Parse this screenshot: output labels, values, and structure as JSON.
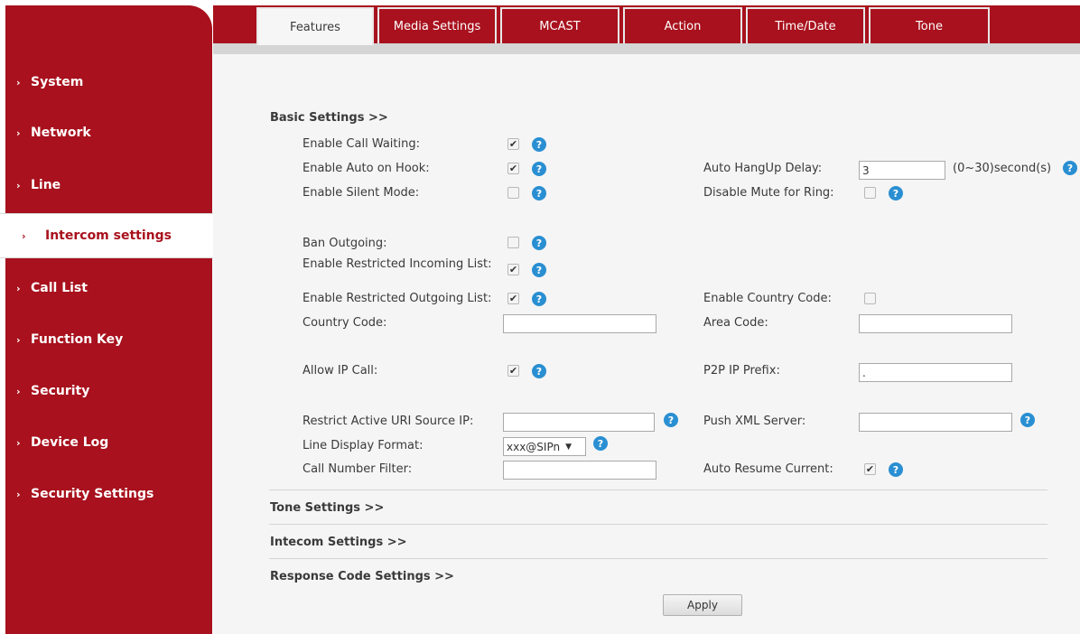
{
  "sidebar": {
    "items": [
      {
        "label": "System"
      },
      {
        "label": "Network"
      },
      {
        "label": "Line"
      },
      {
        "label": "Intercom settings"
      },
      {
        "label": "Call List"
      },
      {
        "label": "Function Key"
      },
      {
        "label": "Security"
      },
      {
        "label": "Device Log"
      },
      {
        "label": "Security Settings"
      }
    ],
    "active": "Intercom settings"
  },
  "tabs": [
    {
      "label": "Features"
    },
    {
      "label": "Media Settings"
    },
    {
      "label": "MCAST"
    },
    {
      "label": "Action"
    },
    {
      "label": "Time/Date"
    },
    {
      "label": "Tone"
    }
  ],
  "active_tab": "Features",
  "basic": {
    "title": "Basic Settings >>",
    "call_waiting": {
      "label": "Enable Call Waiting:",
      "checked": true
    },
    "auto_on_hook": {
      "label": "Enable Auto on Hook:",
      "checked": true
    },
    "silent_mode": {
      "label": "Enable Silent Mode:",
      "checked": false
    },
    "hangup_delay": {
      "label": "Auto HangUp Delay:",
      "value": "3",
      "unit": "(0~30)second(s)"
    },
    "disable_mute": {
      "label": "Disable Mute for Ring:",
      "checked": false
    },
    "ban_outgoing": {
      "label": "Ban Outgoing:",
      "checked": false
    },
    "restricted_incoming": {
      "label": "Enable Restricted Incoming List:",
      "checked": true
    },
    "restricted_outgoing": {
      "label": "Enable Restricted Outgoing List:",
      "checked": true
    },
    "country_code_enable": {
      "label": "Enable Country Code:",
      "checked": false
    },
    "country_code": {
      "label": "Country Code:",
      "value": ""
    },
    "area_code": {
      "label": "Area Code:",
      "value": ""
    },
    "allow_ip_call": {
      "label": "Allow IP Call:",
      "checked": true
    },
    "p2p_prefix": {
      "label": "P2P IP Prefix:",
      "value": "."
    },
    "restrict_uri": {
      "label": "Restrict Active URI Source IP:",
      "value": ""
    },
    "push_xml": {
      "label": "Push XML Server:",
      "value": ""
    },
    "line_display": {
      "label": "Line Display Format:",
      "value": "xxx@SIPn"
    },
    "call_filter": {
      "label": "Call Number Filter:",
      "value": ""
    },
    "auto_resume": {
      "label": "Auto Resume Current:",
      "checked": true
    }
  },
  "sections": {
    "tone": "Tone Settings >>",
    "intercom": "Intecom Settings >>",
    "response": "Response Code Settings >>"
  },
  "apply_label": "Apply",
  "colors": {
    "brand": "#a8111d",
    "help": "#2a8fd2",
    "panel": "#f5f5f5"
  },
  "icons": {
    "help": "question-circle-icon",
    "chevron": "chevron-right-icon",
    "check": "checkmark-icon"
  }
}
